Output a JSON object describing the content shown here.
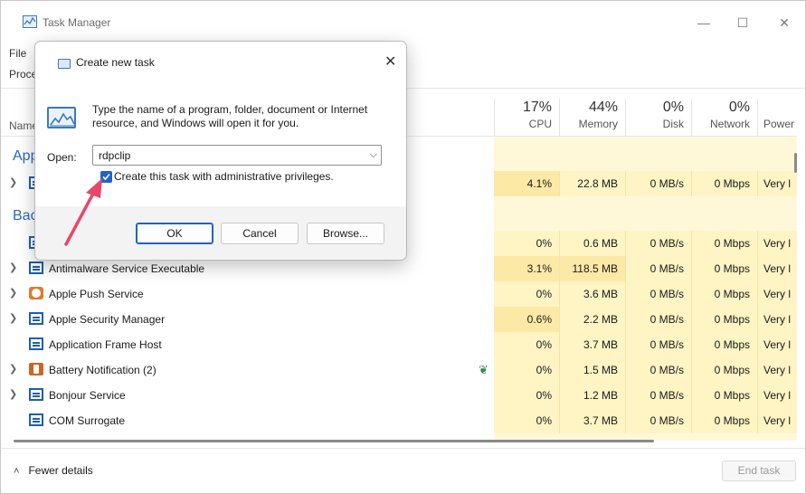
{
  "window": {
    "title": "Task Manager",
    "minimize": "—",
    "maximize": "☐",
    "close": "✕"
  },
  "menu": {
    "file": "File"
  },
  "tabs_partial": "Proce",
  "columns": {
    "name": "Name",
    "cpu": {
      "pct": "17%",
      "label": "CPU"
    },
    "memory": {
      "pct": "44%",
      "label": "Memory"
    },
    "disk": {
      "pct": "0%",
      "label": "Disk"
    },
    "network": {
      "pct": "0%",
      "label": "Network"
    },
    "power": {
      "label": "Power us"
    }
  },
  "groups": {
    "apps": "App",
    "background": "Bac"
  },
  "rows": [
    {
      "name": "",
      "cpu": "4.1%",
      "mem": "22.8 MB",
      "disk": "0 MB/s",
      "net": "0 Mbps",
      "power": "Very l"
    },
    {
      "name": "",
      "cpu": "0%",
      "mem": "0.6 MB",
      "disk": "0 MB/s",
      "net": "0 Mbps",
      "power": "Very l"
    },
    {
      "name": "Antimalware Service Executable",
      "cpu": "3.1%",
      "mem": "118.5 MB",
      "disk": "0 MB/s",
      "net": "0 Mbps",
      "power": "Very l"
    },
    {
      "name": "Apple Push Service",
      "cpu": "0%",
      "mem": "3.6 MB",
      "disk": "0 MB/s",
      "net": "0 Mbps",
      "power": "Very l"
    },
    {
      "name": "Apple Security Manager",
      "cpu": "0.6%",
      "mem": "2.2 MB",
      "disk": "0 MB/s",
      "net": "0 Mbps",
      "power": "Very l"
    },
    {
      "name": "Application Frame Host",
      "cpu": "0%",
      "mem": "3.7 MB",
      "disk": "0 MB/s",
      "net": "0 Mbps",
      "power": "Very l"
    },
    {
      "name": "Battery Notification (2)",
      "cpu": "0%",
      "mem": "1.5 MB",
      "disk": "0 MB/s",
      "net": "0 Mbps",
      "power": "Very l"
    },
    {
      "name": "Bonjour Service",
      "cpu": "0%",
      "mem": "1.2 MB",
      "disk": "0 MB/s",
      "net": "0 Mbps",
      "power": "Very l"
    },
    {
      "name": "COM Surrogate",
      "cpu": "0%",
      "mem": "3.7 MB",
      "disk": "0 MB/s",
      "net": "0 Mbps",
      "power": "Very l"
    }
  ],
  "footer": {
    "fewer_details": "Fewer details",
    "end_task": "End task"
  },
  "dialog": {
    "title": "Create new task",
    "close": "✕",
    "description": "Type the name of a program, folder, document or Internet resource, and Windows will open it for you.",
    "open_label": "Open:",
    "open_value": "rdpclip",
    "admin_checkbox_label": "Create this task with administrative privileges.",
    "admin_checked": true,
    "ok": "OK",
    "cancel": "Cancel",
    "browse": "Browse..."
  },
  "colors": {
    "accent": "#1e64c8",
    "arrow": "#e8476a",
    "heat_light": "#fff4c4",
    "heat_mid": "#fde9a6"
  }
}
